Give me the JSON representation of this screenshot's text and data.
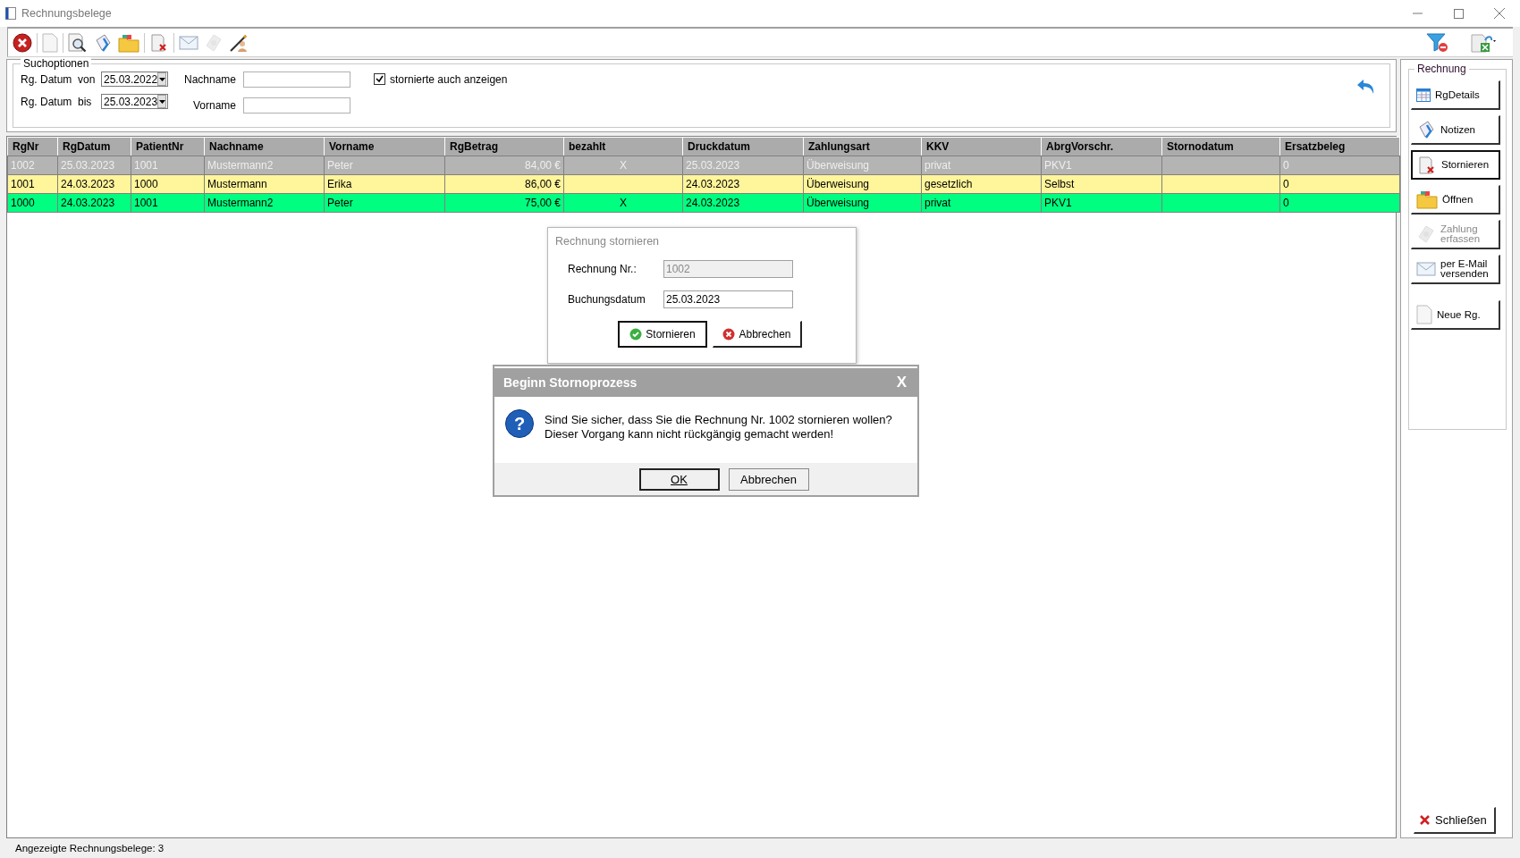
{
  "window": {
    "title": "Rechnungsbelege"
  },
  "toolbar": [
    {
      "kind": "close",
      "disabled": false
    },
    {
      "kind": "new",
      "disabled": false
    },
    {
      "kind": "preview",
      "disabled": false
    },
    {
      "kind": "notes",
      "disabled": false
    },
    {
      "kind": "open",
      "disabled": false
    },
    {
      "kind": "storno",
      "disabled": false
    },
    {
      "kind": "mail",
      "disabled": false
    },
    {
      "kind": "payment",
      "disabled": true
    },
    {
      "kind": "sign",
      "disabled": false
    }
  ],
  "toolbar_right": [
    {
      "kind": "filter"
    },
    {
      "kind": "export"
    }
  ],
  "search": {
    "title": "Suchoptionen",
    "date_from": {
      "label": "Rg. Datum  von",
      "value": "25.03.2022"
    },
    "date_to": {
      "label": "Rg. Datum  bis",
      "value": "25.03.2023"
    },
    "lastname": {
      "label": "Nachname"
    },
    "firstname": {
      "label": "Vorname"
    },
    "show_cancelled": {
      "label": "stornierte auch anzeigen",
      "checked": true
    }
  },
  "table": {
    "columns": [
      "RgNr",
      "RgDatum",
      "PatientNr",
      "Nachname",
      "Vorname",
      "RgBetrag",
      "bezahlt",
      "Druckdatum",
      "Zahlungsart",
      "KKV",
      "AbrgVorschr.",
      "Stornodatum",
      "Ersatzbeleg"
    ],
    "rows": [
      {
        "color": "#b4b4b4",
        "cancelled": true,
        "cells": [
          "1002",
          "25.03.2023",
          "1001",
          "Mustermann2",
          "Peter",
          "84,00 €",
          "X",
          "25.03.2023",
          "Überweisung",
          "privat",
          "PKV1",
          "",
          "0"
        ]
      },
      {
        "color": "#fff59a",
        "cancelled": false,
        "cells": [
          "1001",
          "24.03.2023",
          "1000",
          "Mustermann",
          "Erika",
          "86,00 €",
          "",
          "24.03.2023",
          "Überweisung",
          "gesetzlich",
          "Selbst",
          "",
          "0"
        ]
      },
      {
        "color": "#00ff80",
        "cancelled": false,
        "cells": [
          "1000",
          "24.03.2023",
          "1001",
          "Mustermann2",
          "Peter",
          "75,00 €",
          "X",
          "24.03.2023",
          "Überweisung",
          "privat",
          "PKV1",
          "",
          "0"
        ]
      }
    ]
  },
  "side_panel": {
    "title": "Rechnung",
    "buttons": [
      {
        "kind": "details",
        "label": "RgDetails",
        "disabled": false,
        "focused": false
      },
      {
        "kind": "notes",
        "label": "Notizen",
        "disabled": false,
        "focused": false
      },
      {
        "kind": "storno",
        "label": "Stornieren",
        "disabled": false,
        "focused": true
      },
      {
        "kind": "open",
        "label": "Öffnen",
        "disabled": false,
        "focused": false
      },
      {
        "kind": "payment",
        "label": "Zahlung\nerfassen",
        "disabled": true,
        "focused": false
      },
      {
        "kind": "mail",
        "label": "per E-Mail\nversenden",
        "disabled": false,
        "focused": false
      },
      {
        "kind": "new",
        "label": "Neue Rg.",
        "disabled": false,
        "focused": false
      }
    ],
    "close_button": {
      "label": "Schließen"
    }
  },
  "status_bar": "Angezeigte Rechnungsbelege: 3",
  "storno_dialog": {
    "title": "Rechnung stornieren",
    "fields": [
      {
        "label": "Rechnung Nr.:",
        "value": "1002",
        "disabled": true
      },
      {
        "label": "Buchungsdatum",
        "value": "25.03.2023",
        "disabled": false
      }
    ],
    "buttons": [
      {
        "kind": "confirm",
        "label": "Stornieren",
        "focused": true
      },
      {
        "kind": "cancel",
        "label": "Abbrechen",
        "focused": false
      }
    ]
  },
  "confirm_dialog": {
    "title": "Beginn Stornoprozess",
    "close": "X",
    "icon": "?",
    "message": "Sind Sie sicher, dass Sie die Rechnung Nr. 1002 stornieren wollen?\nDieser Vorgang kann nicht rückgängig gemacht werden!",
    "buttons": [
      {
        "label": "OK",
        "default": true
      },
      {
        "label": "Abbrechen",
        "default": false
      }
    ]
  }
}
